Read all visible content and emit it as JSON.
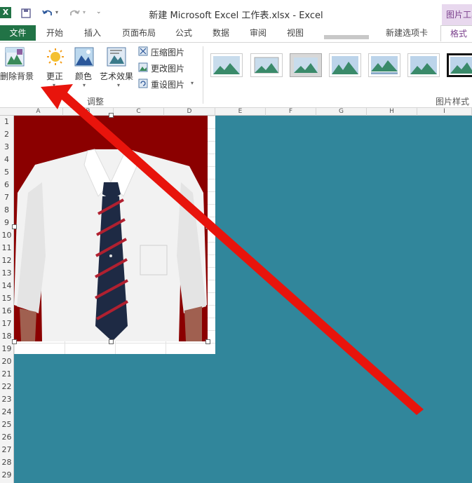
{
  "window": {
    "title": "新建 Microsoft Excel 工作表.xlsx - Excel",
    "context_tab_group": "图片工具"
  },
  "tabs": [
    {
      "label": "文件"
    },
    {
      "label": "开始"
    },
    {
      "label": "插入"
    },
    {
      "label": "页面布局"
    },
    {
      "label": "公式"
    },
    {
      "label": "数据"
    },
    {
      "label": "审阅"
    },
    {
      "label": "视图"
    },
    {
      "label": "新建选项卡"
    },
    {
      "label": "格式"
    }
  ],
  "ribbon": {
    "remove_background": "删除背景",
    "corrections": "更正",
    "color": "颜色",
    "artistic_effects": "艺术效果",
    "compress": "压缩图片",
    "change": "更改图片",
    "reset": "重设图片",
    "group_adjust": "调整",
    "group_styles": "图片样式"
  },
  "columns": [
    "A",
    "B",
    "C",
    "D",
    "E",
    "F",
    "G",
    "H",
    "I"
  ],
  "rows": [
    "1",
    "2",
    "3",
    "4",
    "5",
    "6",
    "7",
    "8",
    "9",
    "10",
    "11",
    "12",
    "13",
    "14",
    "15",
    "16",
    "17",
    "18",
    "19",
    "20",
    "21",
    "22",
    "23",
    "24",
    "25",
    "26",
    "27",
    "28",
    "29"
  ],
  "colors": {
    "excel_green": "#217346",
    "picture_tools_purple": "#7a3f8c",
    "teal_background": "#31869b",
    "photo_background": "#8b0000",
    "arrow": "#e8140c"
  }
}
